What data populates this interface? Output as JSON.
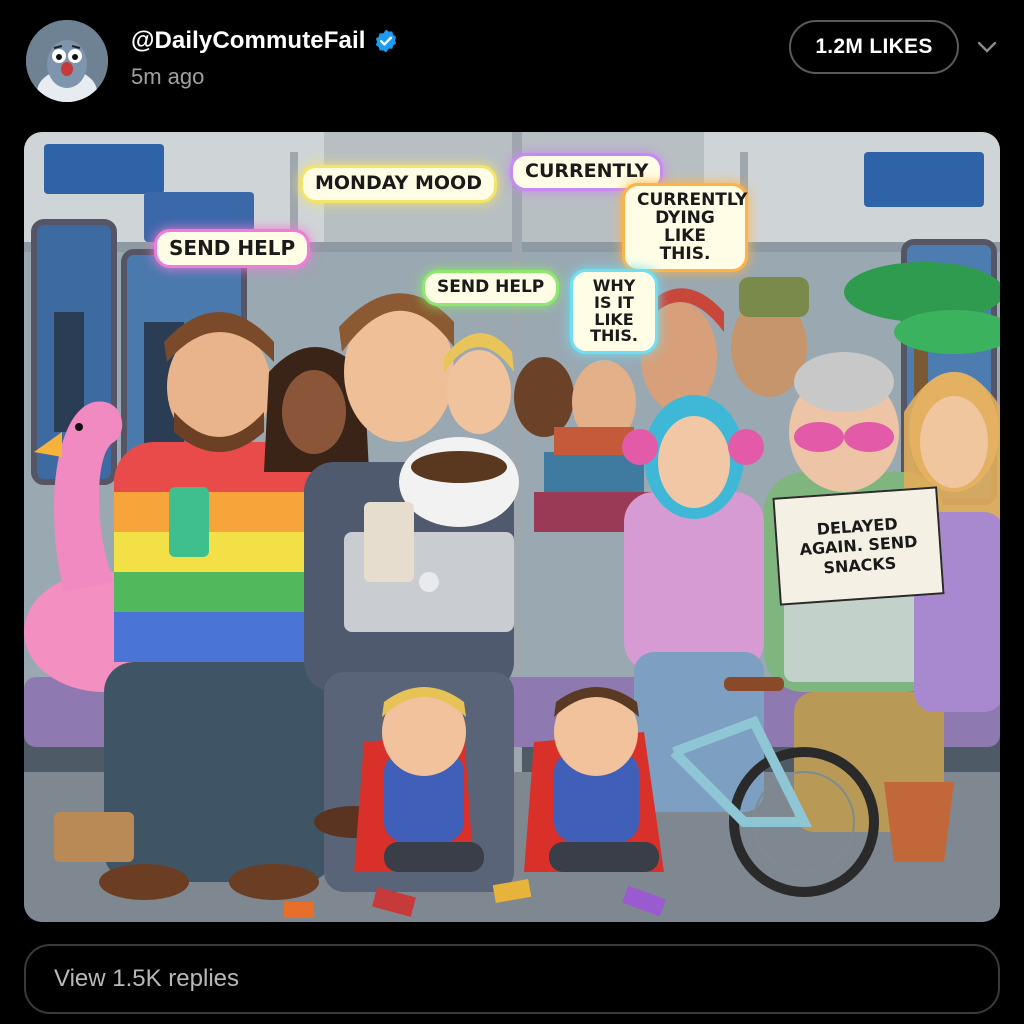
{
  "post": {
    "handle": "@DailyCommuteFail",
    "verified": true,
    "timestamp": "5m ago",
    "likes_label": "1.2M LIKES",
    "replies_label": "View 1.5K replies"
  },
  "image": {
    "speech_bubbles": [
      {
        "text": "SEND HELP",
        "color": "pink"
      },
      {
        "text": "MONDAY MOOD",
        "color": "yellow"
      },
      {
        "text": "SEND HELP",
        "color": "green"
      },
      {
        "text": "CURRENTLY",
        "color": "violet"
      },
      {
        "text": "CURRENTLY DYING LIKE THIS.",
        "color": "orange"
      },
      {
        "text": "WHY IS IT LIKE THIS.",
        "color": "cyan"
      }
    ],
    "sign_text": "DELAYED AGAIN. SEND SNACKS"
  },
  "icons": {
    "avatar": "pigeon-avatar-icon",
    "verified": "verified-badge-icon",
    "more": "chevron-down-icon"
  },
  "colors": {
    "background": "#000000",
    "verified": "#1d9bf0",
    "secondary_text": "#a0a0a0"
  }
}
